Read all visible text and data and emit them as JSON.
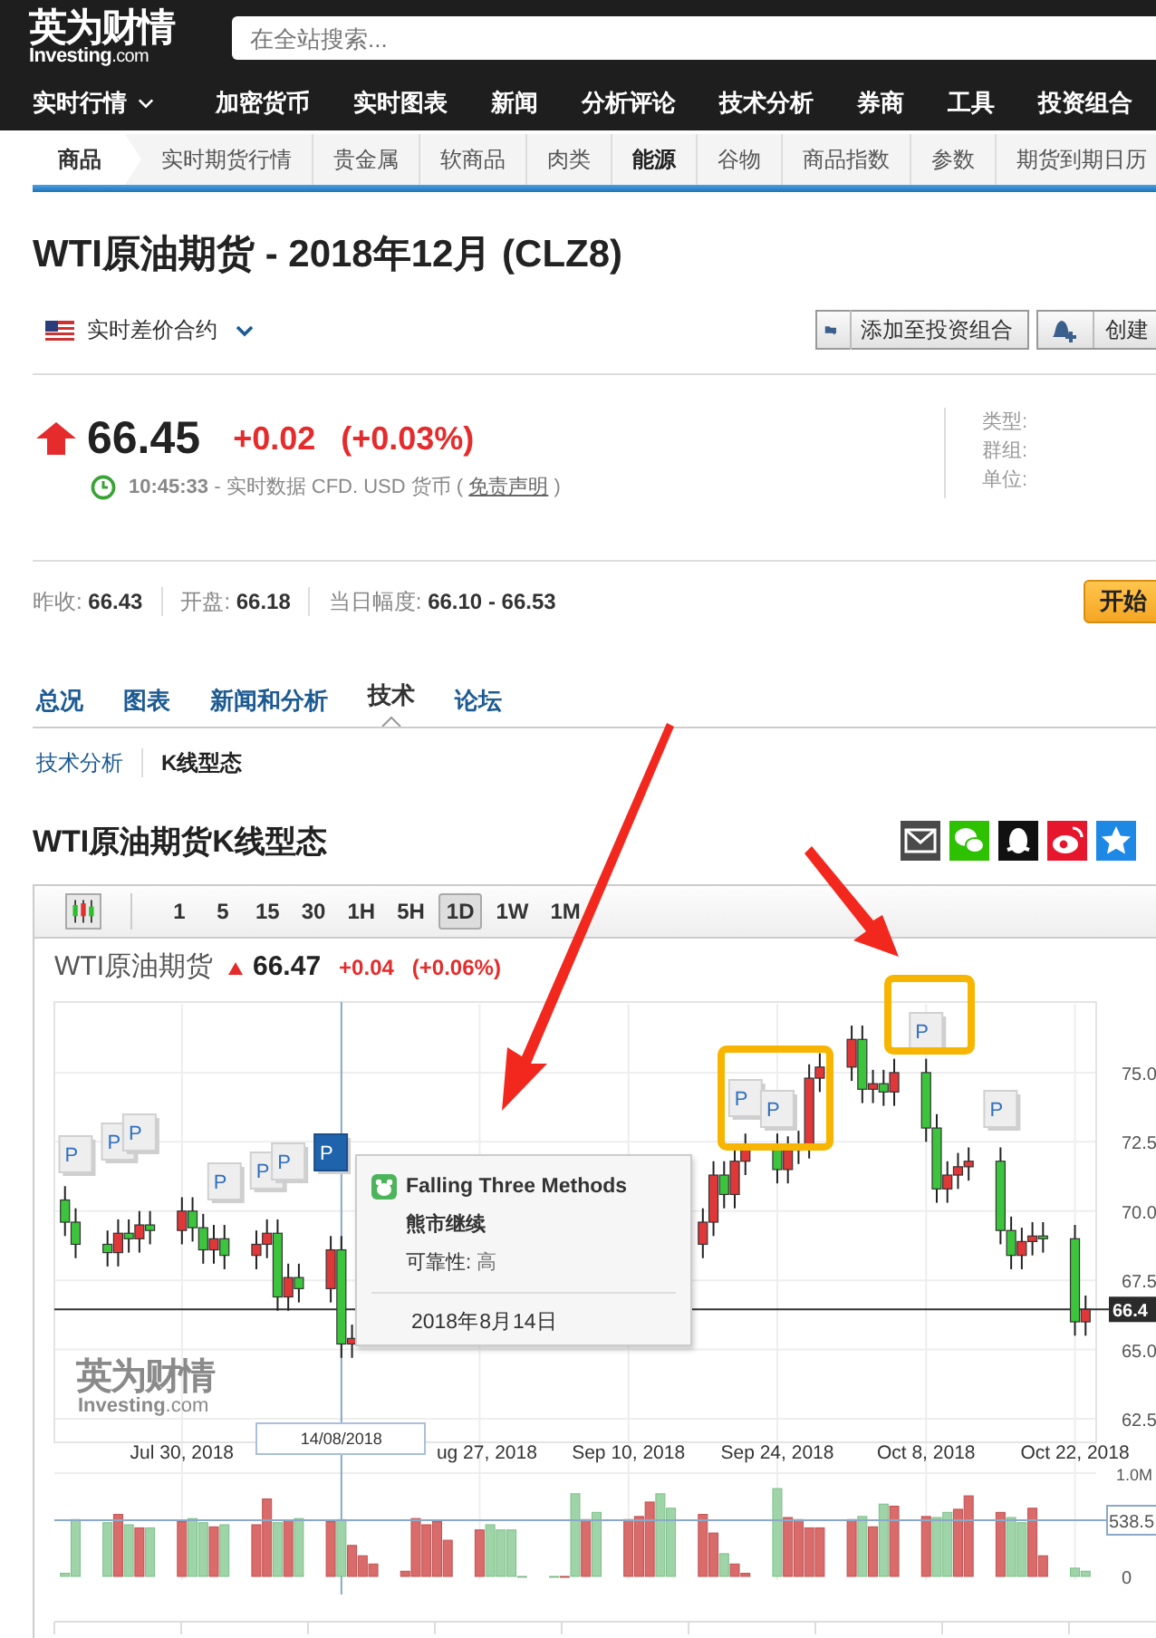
{
  "header": {
    "logo_cn": "英为财情",
    "logo_en": "Investing",
    "logo_tld": ".com",
    "search": {
      "placeholder": "在全站搜索..."
    }
  },
  "nav": [
    {
      "label": "实时行情",
      "has_menu": true
    },
    {
      "label": "加密货币",
      "has_menu": false
    },
    {
      "label": "实时图表",
      "has_menu": false
    },
    {
      "label": "新闻",
      "has_menu": false
    },
    {
      "label": "分析评论",
      "has_menu": false
    },
    {
      "label": "技术分析",
      "has_menu": false
    },
    {
      "label": "券商",
      "has_menu": false
    },
    {
      "label": "工具",
      "has_menu": false
    },
    {
      "label": "投资组合",
      "has_menu": false
    }
  ],
  "subnav": [
    {
      "label": "商品",
      "kind": "root",
      "selected": false
    },
    {
      "label": "实时期货行情",
      "kind": "link",
      "selected": false
    },
    {
      "label": "贵金属",
      "kind": "link",
      "selected": false
    },
    {
      "label": "软商品",
      "kind": "link",
      "selected": false
    },
    {
      "label": "肉类",
      "kind": "link",
      "selected": false
    },
    {
      "label": "能源",
      "kind": "link",
      "selected": true
    },
    {
      "label": "谷物",
      "kind": "link",
      "selected": false
    },
    {
      "label": "商品指数",
      "kind": "link",
      "selected": false
    },
    {
      "label": "参数",
      "kind": "link",
      "selected": false
    },
    {
      "label": "期货到期日历",
      "kind": "link",
      "selected": false
    }
  ],
  "title": "WTI原油期货 - 2018年12月 (CLZ8)",
  "contract": {
    "label": "实时差价合约"
  },
  "actions": [
    {
      "label": "添加至投资组合",
      "kind": "portfolio"
    },
    {
      "label": "创建",
      "kind": "alert"
    }
  ],
  "quote": {
    "rising": true,
    "price": "66.45",
    "change": "+0.02",
    "change_pct": "(+0.03%)",
    "time": "10:45:33",
    "note": "- 实时数据 CFD. USD 货币 (",
    "link": "免责声明",
    "note_end": ")"
  },
  "details": [
    "类型:",
    "群组:",
    "单位:"
  ],
  "stats": [
    {
      "label": "昨收:",
      "value": "66.43"
    },
    {
      "label": "开盘:",
      "value": "66.18"
    },
    {
      "label": "当日幅度:",
      "value": "66.10 - 66.53"
    }
  ],
  "trade_button": "开始",
  "tabs": [
    {
      "label": "总况",
      "selected": false
    },
    {
      "label": "图表",
      "selected": false
    },
    {
      "label": "新闻和分析",
      "selected": false
    },
    {
      "label": "技术",
      "selected": true
    },
    {
      "label": "论坛",
      "selected": false
    }
  ],
  "subtabs": [
    {
      "label": "技术分析",
      "selected": false
    },
    {
      "label": "K线型态",
      "selected": true
    }
  ],
  "section_title": "WTI原油期货K线型态",
  "share": [
    {
      "kind": "email"
    },
    {
      "kind": "wechat"
    },
    {
      "kind": "qq"
    },
    {
      "kind": "weibo"
    },
    {
      "kind": "favorite"
    }
  ],
  "chart": {
    "intervals": [
      {
        "label": "1",
        "selected": false
      },
      {
        "label": "5",
        "selected": false
      },
      {
        "label": "15",
        "selected": false
      },
      {
        "label": "30",
        "selected": false
      },
      {
        "label": "1H",
        "selected": false
      },
      {
        "label": "5H",
        "selected": false
      },
      {
        "label": "1D",
        "selected": true
      },
      {
        "label": "1W",
        "selected": false
      },
      {
        "label": "1M",
        "selected": false
      }
    ],
    "name": "WTI原油期货",
    "rising": true,
    "price": "66.47",
    "change": "+0.04",
    "change_pct": "(+0.06%)",
    "chart_data": {
      "type": "candlestick",
      "x": [
        "2018-07-19",
        "2018-07-20",
        "2018-07-23",
        "2018-07-24",
        "2018-07-25",
        "2018-07-26",
        "2018-07-27",
        "2018-07-30",
        "2018-07-31",
        "2018-08-01",
        "2018-08-02",
        "2018-08-03",
        "2018-08-06",
        "2018-08-07",
        "2018-08-08",
        "2018-08-09",
        "2018-08-10",
        "2018-08-13",
        "2018-08-14",
        "2018-08-15",
        "2018-09-17",
        "2018-09-18",
        "2018-09-19",
        "2018-09-20",
        "2018-09-21",
        "2018-09-24",
        "2018-09-25",
        "2018-09-26",
        "2018-09-27",
        "2018-09-28",
        "2018-10-01",
        "2018-10-02",
        "2018-10-03",
        "2018-10-04",
        "2018-10-05",
        "2018-10-08",
        "2018-10-09",
        "2018-10-10",
        "2018-10-11",
        "2018-10-12",
        "2018-10-15",
        "2018-10-16",
        "2018-10-17",
        "2018-10-18",
        "2018-10-19",
        "2018-10-22",
        "2018-10-23"
      ],
      "ohlc": [
        [
          70.4,
          70.9,
          69.1,
          69.6
        ],
        [
          69.6,
          70.1,
          68.3,
          68.8
        ],
        [
          68.8,
          69.3,
          68.0,
          68.5
        ],
        [
          68.5,
          69.7,
          68.0,
          69.2
        ],
        [
          69.2,
          69.7,
          68.5,
          69.0
        ],
        [
          69.0,
          70.0,
          68.5,
          69.5
        ],
        [
          69.5,
          70.0,
          68.8,
          69.3
        ],
        [
          69.3,
          70.5,
          68.8,
          70.0
        ],
        [
          70.0,
          70.5,
          68.9,
          69.4
        ],
        [
          69.4,
          69.9,
          68.1,
          68.6
        ],
        [
          68.6,
          69.5,
          68.1,
          69.0
        ],
        [
          69.0,
          69.5,
          67.9,
          68.4
        ],
        [
          68.4,
          69.3,
          67.9,
          68.8
        ],
        [
          68.8,
          69.7,
          68.3,
          69.2
        ],
        [
          69.2,
          69.7,
          66.4,
          66.9
        ],
        [
          66.9,
          68.1,
          66.4,
          67.6
        ],
        [
          67.6,
          68.1,
          66.7,
          67.2
        ],
        [
          67.2,
          69.1,
          66.7,
          68.6
        ],
        [
          68.6,
          69.1,
          64.7,
          65.2
        ],
        [
          65.2,
          65.9,
          64.7,
          65.4
        ],
        [
          68.8,
          70.1,
          68.3,
          69.6
        ],
        [
          69.6,
          71.8,
          69.1,
          71.3
        ],
        [
          71.3,
          71.8,
          70.1,
          70.6
        ],
        [
          70.6,
          72.3,
          70.1,
          71.8
        ],
        [
          71.8,
          72.8,
          71.3,
          72.3
        ],
        [
          72.3,
          72.8,
          71.0,
          71.5
        ],
        [
          71.5,
          72.7,
          71.0,
          72.2
        ],
        [
          72.2,
          72.9,
          71.7,
          72.4
        ],
        [
          72.4,
          75.3,
          71.9,
          74.8
        ],
        [
          74.8,
          75.7,
          74.3,
          75.2
        ],
        [
          75.2,
          76.7,
          74.7,
          76.2
        ],
        [
          76.2,
          76.7,
          73.9,
          74.4
        ],
        [
          74.4,
          75.1,
          73.9,
          74.6
        ],
        [
          74.6,
          75.1,
          73.8,
          74.3
        ],
        [
          74.3,
          75.5,
          73.8,
          75.0
        ],
        [
          75.0,
          75.5,
          72.5,
          73.0
        ],
        [
          73.0,
          73.5,
          70.3,
          70.8
        ],
        [
          70.8,
          71.8,
          70.3,
          71.3
        ],
        [
          71.3,
          72.1,
          70.8,
          71.6
        ],
        [
          71.6,
          72.3,
          71.1,
          71.8
        ],
        [
          71.8,
          72.3,
          68.8,
          69.3
        ],
        [
          69.3,
          69.8,
          67.9,
          68.4
        ],
        [
          68.4,
          69.4,
          67.9,
          68.9
        ],
        [
          68.9,
          69.6,
          68.4,
          69.1
        ],
        [
          69.1,
          69.6,
          68.5,
          69.0
        ],
        [
          69.0,
          69.5,
          65.5,
          66.0
        ],
        [
          66.0,
          66.95,
          65.5,
          66.45
        ]
      ],
      "ref_lines": [
        {
          "axis": "x",
          "value": "2018-08-14",
          "label": "14/08/2018"
        },
        {
          "axis": "y",
          "value": 66.45,
          "label": "66.4"
        }
      ],
      "ylim": [
        61.65,
        77.55
      ],
      "xlim": [
        "2018-07-18",
        "2018-10-24"
      ],
      "grid": true,
      "xticks": [
        {
          "value": "2018-07-30",
          "label": "Jul 30, 2018"
        },
        {
          "value": "2018-08-27",
          "label": "ug 27, 2018"
        },
        {
          "value": "2018-09-10",
          "label": "Sep 10, 2018"
        },
        {
          "value": "2018-09-24",
          "label": "Sep 24, 2018"
        },
        {
          "value": "2018-10-08",
          "label": "Oct 8, 2018"
        },
        {
          "value": "2018-10-22",
          "label": "Oct 22, 2018"
        }
      ],
      "yticks": [
        {
          "value": 75,
          "label": "75.0"
        },
        {
          "value": 72.5,
          "label": "72.5"
        },
        {
          "value": 70,
          "label": "70.0"
        },
        {
          "value": 67.5,
          "label": "67.5"
        },
        {
          "value": 65,
          "label": "65.0"
        },
        {
          "value": 62.5,
          "label": "62.5"
        }
      ]
    },
    "volume_labels": [
      "1.0M",
      "538.5",
      "0"
    ],
    "watermark_cn": "英为财情",
    "watermark_en": "Investing",
    "watermark_tld": ".com",
    "markers": [
      {
        "label": "P",
        "selected": false
      },
      {
        "label": "P",
        "selected": false
      },
      {
        "label": "P",
        "selected": false
      },
      {
        "label": "P",
        "selected": false
      },
      {
        "label": "P",
        "selected": false
      },
      {
        "label": "P",
        "selected": false
      },
      {
        "label": "P",
        "selected": true
      },
      {
        "label": "P",
        "selected": false
      },
      {
        "label": "P",
        "selected": false
      },
      {
        "label": "P",
        "selected": false
      },
      {
        "label": "P",
        "selected": false
      }
    ],
    "tooltip": {
      "title": "Falling Three Methods",
      "signal": "熊市继续",
      "reliability_label": "可靠性:",
      "reliability": "高",
      "date": "2018年8月14日"
    }
  }
}
